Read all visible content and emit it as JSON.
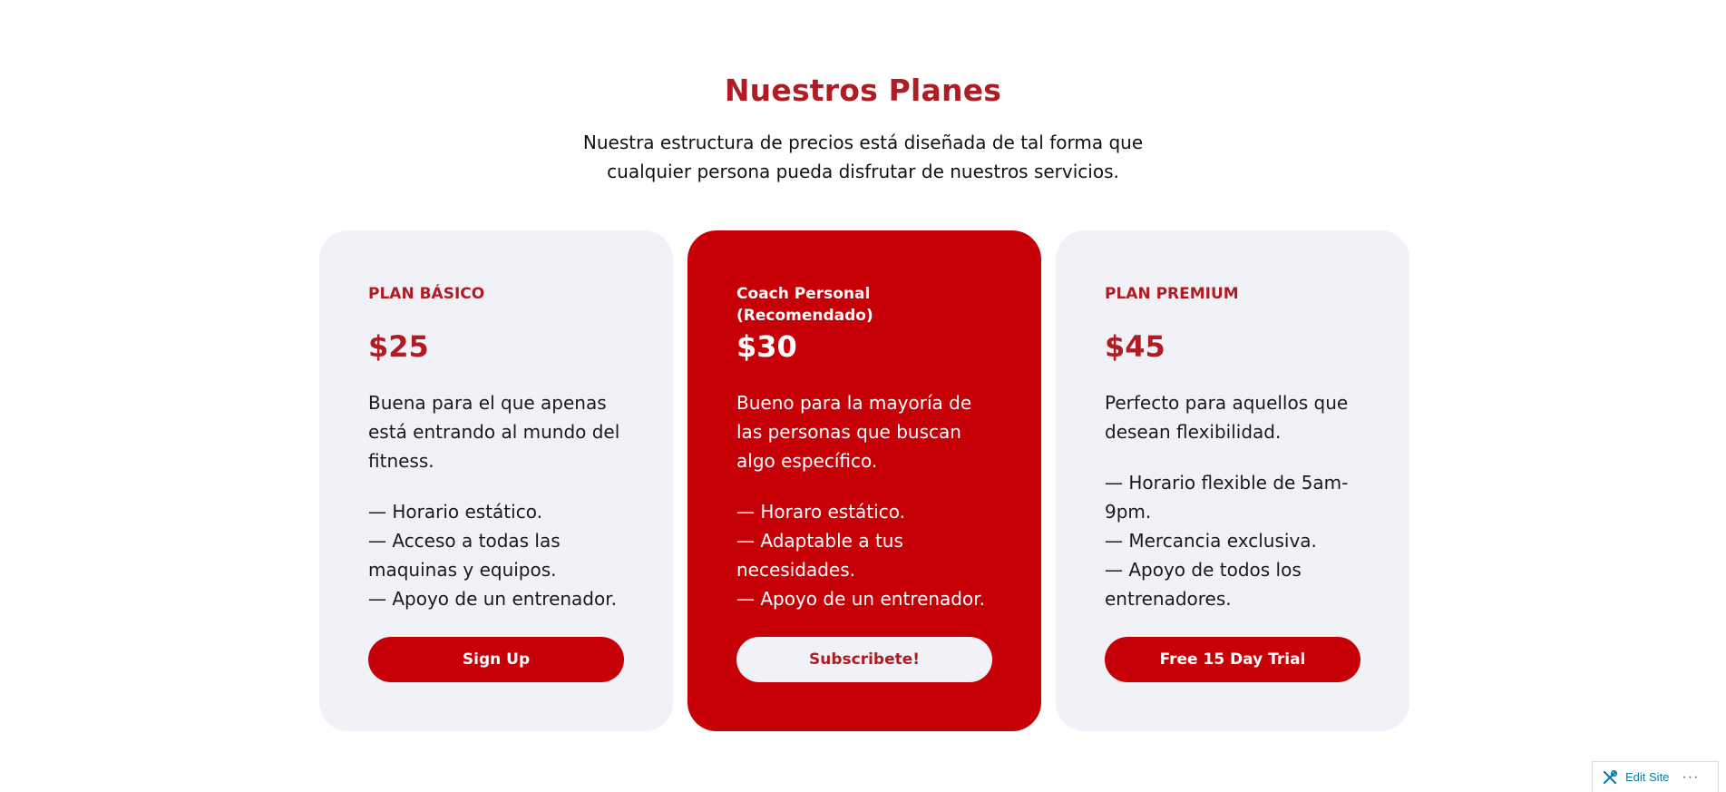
{
  "section": {
    "title": "Nuestros Planes",
    "subtitle": "Nuestra estructura de precios está diseñada de tal forma que cualquier persona pueda disfrutar de nuestros servicios."
  },
  "plans": [
    {
      "name": "PLAN BÁSICO",
      "price": "$25",
      "description": "Buena para el que apenas está entrando al mundo del fitness.",
      "features": [
        "— Horario estático.",
        "— Acceso a todas las maquinas y equipos.",
        "— Apoyo de un entrenador."
      ],
      "cta": "Sign Up"
    },
    {
      "name": "Coach Personal (Recomendado)",
      "price": "$30",
      "description": "Bueno para la mayoría de las personas que buscan algo específico.",
      "features": [
        "— Horaro estático.",
        "— Adaptable a tus necesidades.",
        "— Apoyo de un entrenador."
      ],
      "cta": "Subscribete!"
    },
    {
      "name": "PLAN PREMIUM",
      "price": "$45",
      "description": "Perfecto para aquellos que desean flexibilidad.",
      "features": [
        "— Horario flexible de 5am-9pm.",
        "— Mercancia exclusiva.",
        "— Apoyo de todos los entrenadores."
      ],
      "cta": "Free 15 Day Trial"
    }
  ],
  "admin_bar": {
    "edit_label": "Edit Site",
    "more_label": "···",
    "edit_icon": "tools-icon",
    "more_icon": "ellipsis-icon"
  },
  "colors": {
    "accent": "#b01c24",
    "featured_bg": "#c70007",
    "card_bg": "#f1f2f7",
    "link": "#0a7ea4"
  }
}
